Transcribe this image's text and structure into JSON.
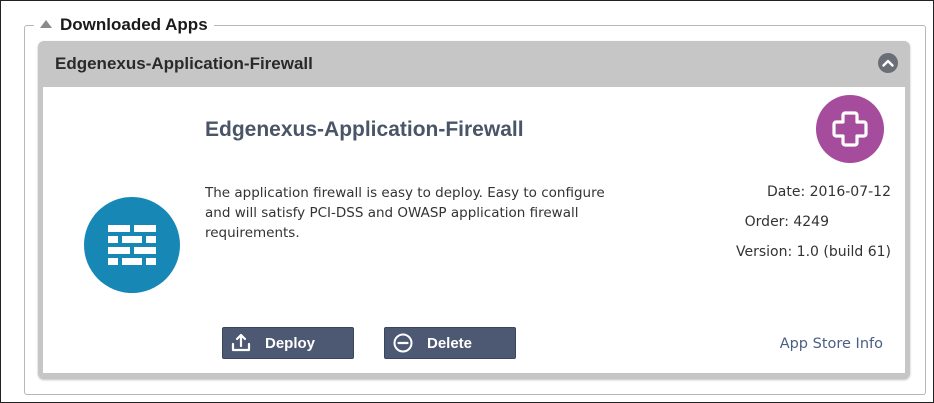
{
  "section": {
    "title": "Downloaded Apps"
  },
  "app_panel": {
    "header_title": "Edgenexus-Application-Firewall",
    "app_name": "Edgenexus-Application-Firewall",
    "description": "The application firewall is easy to deploy. Easy to configure and will satisfy PCI-DSS and OWASP application firewall requirements.",
    "date": "Date: 2016-07-12",
    "order": "Order: 4249",
    "version": "Version: 1.0 (build 61)",
    "deploy_label": "Deploy",
    "delete_label": "Delete",
    "store_link_label": "App Store Info"
  },
  "colors": {
    "logo_blue": "#1787b6",
    "plus_purple": "#a64c9c",
    "button_navy": "#4d5873",
    "panel_gray": "#c6c6c6"
  },
  "icons": {
    "legend": "collapse-triangle-icon",
    "header": "collapse-chevron-up-icon",
    "logo": "firewall-brick-icon",
    "badge": "plus-icon",
    "deploy": "deploy-upload-icon",
    "delete": "delete-minus-circle-icon"
  }
}
